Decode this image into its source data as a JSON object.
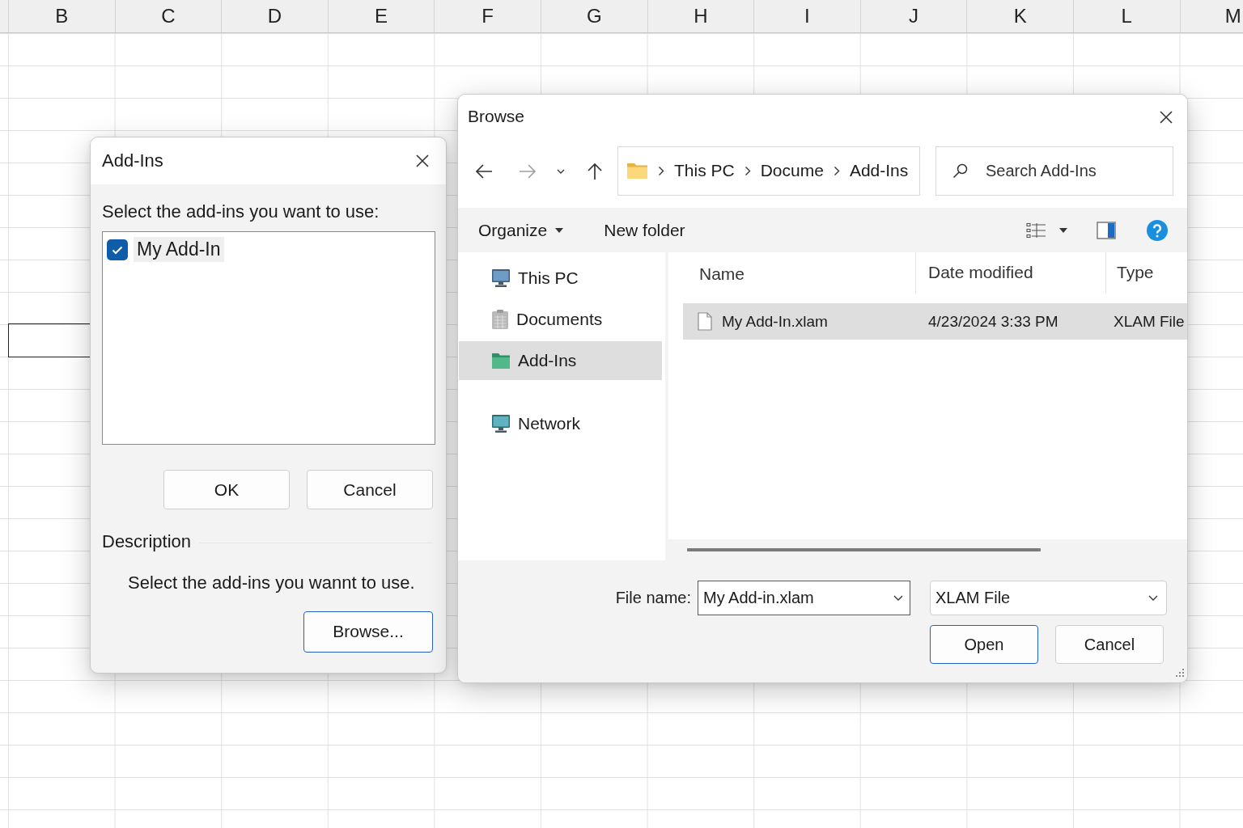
{
  "spreadsheet": {
    "column_headers": [
      "B",
      "C",
      "D",
      "E",
      "F",
      "G",
      "H",
      "I",
      "J",
      "K",
      "L",
      "M"
    ]
  },
  "addins_dialog": {
    "title": "Add-Ins",
    "prompt": "Select the add-ins you want to use:",
    "addins": [
      {
        "name": "My Add-In",
        "checked": true,
        "selected": true
      }
    ],
    "buttons": [
      {
        "label": "OK",
        "default": false
      },
      {
        "label": "Cancel",
        "default": false
      }
    ],
    "description": {
      "heading": "Description",
      "text": "Select the add-ins you wannt to use."
    },
    "browse_button": {
      "label": "Browse...",
      "default": true
    }
  },
  "browse_dialog": {
    "title": "Browse",
    "nav_buttons": [
      {
        "kind": "back",
        "disabled": false
      },
      {
        "kind": "forward",
        "disabled": true
      },
      {
        "kind": "recent",
        "disabled": false
      },
      {
        "kind": "up",
        "disabled": false
      }
    ],
    "address": [
      "This PC",
      "Docume",
      "Add-Ins"
    ],
    "search": {
      "placeholder": "Search Add-Ins"
    },
    "toolbar": {
      "organize": "Organize",
      "new_folder": "New folder"
    },
    "nav_groups": [
      {
        "items": [
          {
            "label": "This PC",
            "kind": "computer",
            "selected": false
          },
          {
            "label": "Documents",
            "kind": "documents",
            "selected": false
          },
          {
            "label": "Add-Ins",
            "kind": "folder",
            "selected": true
          }
        ]
      },
      {
        "items": [
          {
            "label": "Network",
            "kind": "network",
            "selected": false
          }
        ]
      }
    ],
    "columns": [
      "Name",
      "Date modified",
      "Type"
    ],
    "files": [
      {
        "name": "My Add-In.xlam",
        "date_modified": "4/23/2024 3:33 PM",
        "type": "XLAM File",
        "selected": true
      }
    ],
    "file_name": {
      "label": "File name:",
      "value": "My Add-in.xlam"
    },
    "file_type": {
      "value": "XLAM File"
    },
    "buttons": [
      {
        "label": "Open",
        "default": true
      },
      {
        "label": "Cancel",
        "default": false
      }
    ]
  }
}
